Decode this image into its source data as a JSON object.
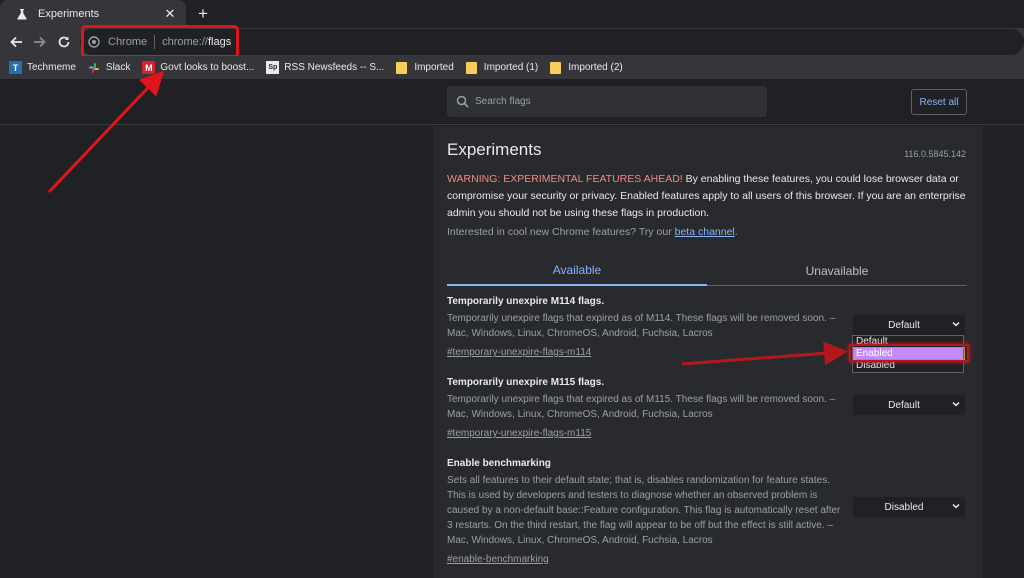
{
  "browser": {
    "tab": {
      "title": "Experiments"
    },
    "new_tab_label": "+",
    "close_glyph": "✕",
    "omnibox": {
      "chip": "Chrome",
      "url_prefix": "chrome://",
      "url_path": "flags"
    },
    "bookmarks": [
      {
        "label": "Techmeme",
        "icon": "techmeme-icon"
      },
      {
        "label": "Slack",
        "icon": "slack-icon"
      },
      {
        "label": "Govt looks to boost...",
        "icon": "m-icon"
      },
      {
        "label": "RSS Newsfeeds -- S...",
        "icon": "sp-icon"
      },
      {
        "label": "Imported",
        "icon": "folder-icon"
      },
      {
        "label": "Imported (1)",
        "icon": "folder-icon"
      },
      {
        "label": "Imported (2)",
        "icon": "folder-icon"
      }
    ]
  },
  "flags_header": {
    "search_placeholder": "Search flags",
    "reset_label": "Reset all"
  },
  "page": {
    "title": "Experiments",
    "version": "116.0.5845.142",
    "warning_prefix": "WARNING: EXPERIMENTAL FEATURES AHEAD!",
    "warning_body": " By enabling these features, you could lose browser data or compromise your security or privacy. Enabled features apply to all users of this browser. If you are an enterprise admin you should not be using these flags in production.",
    "interest_text": "Interested in cool new Chrome features? Try our ",
    "interest_link": "beta channel",
    "interest_end": ".",
    "tabs": {
      "available": "Available",
      "unavailable": "Unavailable"
    }
  },
  "experiments": [
    {
      "name": "Temporarily unexpire M114 flags.",
      "desc": "Temporarily unexpire flags that expired as of M114. These flags will be removed soon. – Mac, Windows, Linux, ChromeOS, Android, Fuchsia, Lacros",
      "link": "#temporary-unexpire-flags-m114",
      "value": "Default"
    },
    {
      "name": "Temporarily unexpire M115 flags.",
      "desc": "Temporarily unexpire flags that expired as of M115. These flags will be removed soon. – Mac, Windows, Linux, ChromeOS, Android, Fuchsia, Lacros",
      "link": "#temporary-unexpire-flags-m115",
      "value": "Default"
    },
    {
      "name": "Enable benchmarking",
      "desc": "Sets all features to their default state; that is, disables randomization for feature states. This is used by developers and testers to diagnose whether an observed problem is caused by a non-default base::Feature configuration. This flag is automatically reset after 3 restarts. On the third restart, the flag will appear to be off but the effect is still active. – Mac, Windows, Linux, ChromeOS, Android, Fuchsia, Lacros",
      "link": "#enable-benchmarking",
      "value": "Disabled"
    }
  ],
  "dropdown_options": [
    "Default",
    "Enabled",
    "Disabled"
  ],
  "colors": {
    "annotation_red": "#e2141b",
    "link_blue": "#8ab4f8",
    "option_highlight": "#c58af9",
    "warning_red": "#f28b82"
  }
}
